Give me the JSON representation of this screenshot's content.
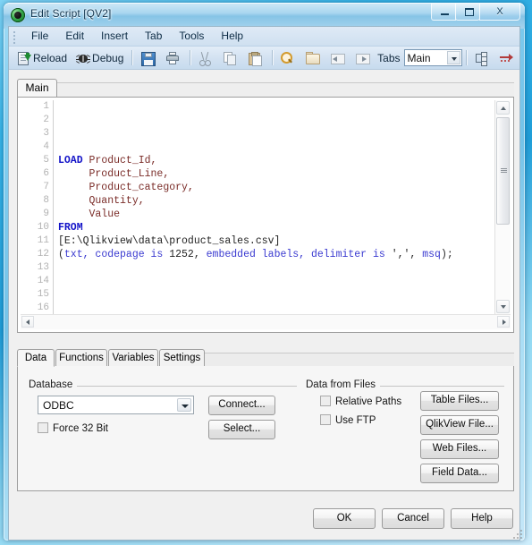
{
  "window": {
    "title": "Edit Script [QV2]",
    "app_icon": "qlikview-logo-icon",
    "minimize_label": "Minimize",
    "maximize_label": "Maximize",
    "close_label": "X"
  },
  "menubar": {
    "items": [
      {
        "label": "File"
      },
      {
        "label": "Edit"
      },
      {
        "label": "Insert"
      },
      {
        "label": "Tab"
      },
      {
        "label": "Tools"
      },
      {
        "label": "Help"
      }
    ]
  },
  "toolbar": {
    "reload_label": "Reload",
    "debug_label": "Debug",
    "tabs_label": "Tabs",
    "tabs_value": "Main",
    "icons": {
      "save": "save-icon",
      "print": "print-icon",
      "cut": "cut-icon",
      "copy": "copy-icon",
      "paste": "paste-icon",
      "find": "find-icon",
      "open": "open-folder-icon",
      "prev_tab": "previous-tab-icon",
      "next_tab": "next-tab-icon",
      "promote": "promote-tab-icon",
      "goto": "goto-icon"
    }
  },
  "script_tabs": [
    {
      "label": "Main",
      "active": true
    }
  ],
  "editor": {
    "first_visible_line": 1,
    "last_visible_line": 16,
    "line_numbers": [
      1,
      2,
      3,
      4,
      5,
      6,
      7,
      8,
      9,
      10,
      11,
      12,
      13,
      14,
      15,
      16
    ],
    "lines": [
      {
        "n": 1,
        "segments": []
      },
      {
        "n": 2,
        "segments": []
      },
      {
        "n": 3,
        "segments": []
      },
      {
        "n": 4,
        "segments": []
      },
      {
        "n": 5,
        "segments": [
          {
            "t": "LOAD ",
            "c": "kw"
          },
          {
            "t": "Product_Id,",
            "c": "field"
          }
        ]
      },
      {
        "n": 6,
        "segments": [
          {
            "t": "     Product_Line,",
            "c": "field"
          }
        ]
      },
      {
        "n": 7,
        "segments": [
          {
            "t": "     Product_category,",
            "c": "field"
          }
        ]
      },
      {
        "n": 8,
        "segments": [
          {
            "t": "     Quantity,",
            "c": "field"
          }
        ]
      },
      {
        "n": 9,
        "segments": [
          {
            "t": "     Value",
            "c": "field"
          }
        ]
      },
      {
        "n": 10,
        "segments": [
          {
            "t": "FROM",
            "c": "kw"
          }
        ]
      },
      {
        "n": 11,
        "segments": [
          {
            "t": "[E:\\Qlikview\\data\\product_sales.csv]",
            "c": "path"
          }
        ]
      },
      {
        "n": 12,
        "segments": [
          {
            "t": "(",
            "c": "plain"
          },
          {
            "t": "txt, codepage is",
            "c": "kw2"
          },
          {
            "t": " 1252",
            "c": "num"
          },
          {
            "t": ", ",
            "c": "plain"
          },
          {
            "t": "embedded labels, delimiter is",
            "c": "kw2"
          },
          {
            "t": " ',', ",
            "c": "plain"
          },
          {
            "t": "msq",
            "c": "kw2"
          },
          {
            "t": ");",
            "c": "plain"
          }
        ]
      },
      {
        "n": 13,
        "segments": []
      },
      {
        "n": 14,
        "segments": []
      },
      {
        "n": 15,
        "segments": []
      },
      {
        "n": 16,
        "segments": []
      }
    ],
    "plain_text": "LOAD Product_Id,\n     Product_Line,\n     Product_category,\n     Quantity,\n     Value\nFROM\n[E:\\Qlikview\\data\\product_sales.csv]\n(txt, codepage is 1252, embedded labels, delimiter is ',', msq);"
  },
  "lower_tabs": [
    {
      "label": "Data",
      "active": true
    },
    {
      "label": "Functions",
      "active": false
    },
    {
      "label": "Variables",
      "active": false
    },
    {
      "label": "Settings",
      "active": false
    }
  ],
  "database_group": {
    "title": "Database",
    "provider_value": "ODBC",
    "connect_label": "Connect...",
    "select_label": "Select...",
    "force32_label": "Force 32 Bit",
    "force32_checked": false
  },
  "files_group": {
    "title": "Data from Files",
    "relative_paths_label": "Relative Paths",
    "relative_paths_checked": false,
    "use_ftp_label": "Use FTP",
    "use_ftp_checked": false,
    "buttons": [
      {
        "label": "Table Files..."
      },
      {
        "label": "QlikView File..."
      },
      {
        "label": "Web Files..."
      },
      {
        "label": "Field Data..."
      }
    ]
  },
  "footer": {
    "ok_label": "OK",
    "cancel_label": "Cancel",
    "help_label": "Help"
  },
  "colors": {
    "keyword": "#1212c8",
    "field": "#7a2c28",
    "function": "#3a3ad0",
    "title_text": "#10354f",
    "dialog_bg": "#f0f0f0"
  }
}
